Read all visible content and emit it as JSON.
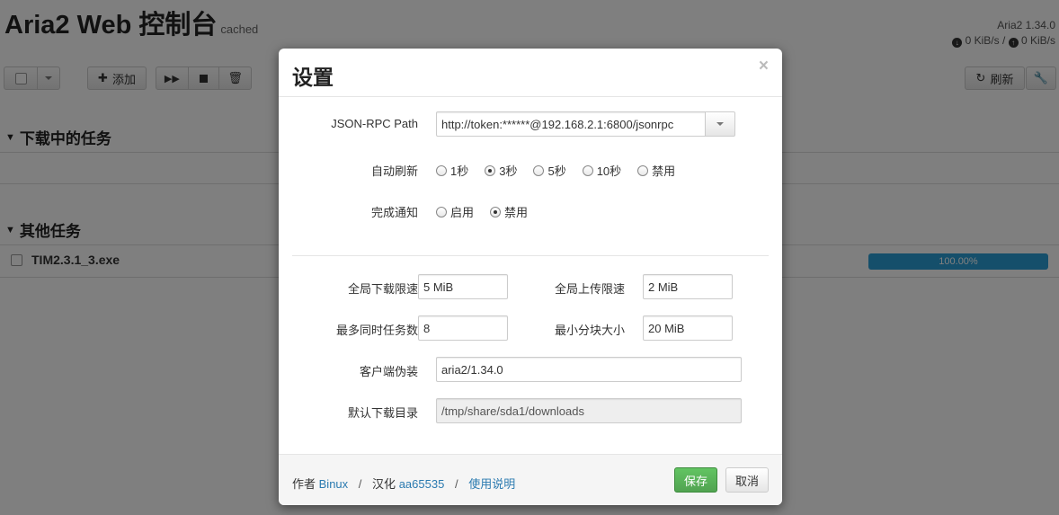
{
  "app": {
    "title": "Aria2 Web 控制台",
    "subtitle": "cached",
    "version": "Aria2 1.34.0",
    "download_speed": "0 KiB/s",
    "speed_separator": "/",
    "upload_speed": "0 KiB/s"
  },
  "toolbar": {
    "add_label": "添加",
    "refresh_label": "刷新"
  },
  "sections": {
    "active_title": "下载中的任务",
    "other_title": "其他任务"
  },
  "tasks": [
    {
      "name": "TIM2.3.1_3.exe",
      "progress_label": "100.00%",
      "progress": 1.0
    }
  ],
  "modal": {
    "title": "设置",
    "close_glyph": "×",
    "rpc": {
      "label": "JSON-RPC Path",
      "value": "http://token:******@192.168.2.1:6800/jsonrpc"
    },
    "auto_refresh": {
      "label": "自动刷新",
      "options": [
        "1秒",
        "3秒",
        "5秒",
        "10秒",
        "禁用"
      ],
      "selected": "3秒"
    },
    "notify": {
      "label": "完成通知",
      "options": [
        "启用",
        "禁用"
      ],
      "selected": "禁用"
    },
    "fields": {
      "global_download_label": "全局下载限速",
      "global_download_value": "5 MiB",
      "global_upload_label": "全局上传限速",
      "global_upload_value": "2 MiB",
      "max_concurrent_label": "最多同时任务数",
      "max_concurrent_value": "8",
      "min_split_label": "最小分块大小",
      "min_split_value": "20 MiB",
      "user_agent_label": "客户端伪装",
      "user_agent_value": "aria2/1.34.0",
      "default_dir_label": "默认下载目录",
      "default_dir_value": "/tmp/share/sda1/downloads"
    },
    "footer": {
      "author_prefix": "作者",
      "author_name": "Binux",
      "sep1": "/",
      "translator_prefix": "汉化",
      "translator_name": "aa65535",
      "sep2": "/",
      "manual_link": "使用说明",
      "save_label": "保存",
      "cancel_label": "取消"
    }
  }
}
